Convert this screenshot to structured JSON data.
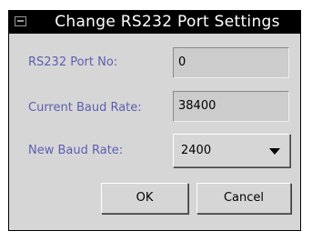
{
  "dialog": {
    "title": "Change RS232 Port Settings"
  },
  "fields": {
    "port_no": {
      "label": "RS232 Port No:",
      "value": "0"
    },
    "current_baud": {
      "label": "Current Baud Rate:",
      "value": "38400"
    },
    "new_baud": {
      "label": "New Baud Rate:",
      "selected": "2400"
    }
  },
  "buttons": {
    "ok": "OK",
    "cancel": "Cancel"
  },
  "icons": {
    "window_menu": "window-menu-icon",
    "dropdown": "chevron-down-icon"
  },
  "colors": {
    "label": "#5b5fb0",
    "titlebar": "#000000",
    "dialog_bg": "#d6d6d6",
    "field_bg": "#cccccc"
  }
}
